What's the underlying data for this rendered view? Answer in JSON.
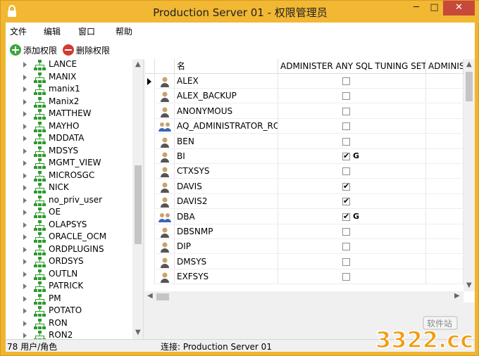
{
  "window": {
    "title": "Production Server 01 - 权限管理员",
    "minimize": "─",
    "maximize": "□",
    "close": "✕",
    "accent_color": "#f2b733"
  },
  "menu": [
    "文件",
    "编辑",
    "窗口",
    "帮助"
  ],
  "toolbar": {
    "add_label": "添加权限",
    "delete_label": "删除权限"
  },
  "tree": {
    "items": [
      "LANCE",
      "MANIX",
      "manix1",
      "Manix2",
      "MATTHEW",
      "MAYHO",
      "MDDATA",
      "MDSYS",
      "MGMT_VIEW",
      "MICROSGC",
      "NICK",
      "no_priv_user",
      "OE",
      "OLAPSYS",
      "ORACLE_OCM",
      "ORDPLUGINS",
      "ORDSYS",
      "OUTLN",
      "PATRICK",
      "PM",
      "POTATO",
      "RON",
      "RON2"
    ]
  },
  "grid": {
    "headers": {
      "name": "名",
      "col1": "ADMINISTER ANY SQL TUNING SET",
      "col2": "ADMINIS"
    },
    "rows": [
      {
        "name": "ALEX",
        "type": "user",
        "checked": false,
        "grant": "",
        "current": true
      },
      {
        "name": "ALEX_BACKUP",
        "type": "user",
        "checked": false,
        "grant": "",
        "current": false
      },
      {
        "name": "ANONYMOUS",
        "type": "user",
        "checked": false,
        "grant": "",
        "current": false
      },
      {
        "name": "AQ_ADMINISTRATOR_RO",
        "type": "role",
        "checked": false,
        "grant": "",
        "current": false
      },
      {
        "name": "BEN",
        "type": "user",
        "checked": false,
        "grant": "",
        "current": false
      },
      {
        "name": "BI",
        "type": "user",
        "checked": true,
        "grant": "G",
        "current": false
      },
      {
        "name": "CTXSYS",
        "type": "user",
        "checked": false,
        "grant": "",
        "current": false
      },
      {
        "name": "DAVIS",
        "type": "user",
        "checked": true,
        "grant": "",
        "current": false
      },
      {
        "name": "DAVIS2",
        "type": "user",
        "checked": true,
        "grant": "",
        "current": false
      },
      {
        "name": "DBA",
        "type": "role",
        "checked": true,
        "grant": "G",
        "current": false
      },
      {
        "name": "DBSNMP",
        "type": "user",
        "checked": false,
        "grant": "",
        "current": false
      },
      {
        "name": "DIP",
        "type": "user",
        "checked": false,
        "grant": "",
        "current": false
      },
      {
        "name": "DMSYS",
        "type": "user",
        "checked": false,
        "grant": "",
        "current": false
      },
      {
        "name": "EXFSYS",
        "type": "user",
        "checked": false,
        "grant": "",
        "current": false
      }
    ]
  },
  "status": {
    "count": "78 用户/角色",
    "connection": "连接: Production Server 01"
  },
  "watermark": {
    "text": "3322.cc",
    "tag": "软件站"
  }
}
